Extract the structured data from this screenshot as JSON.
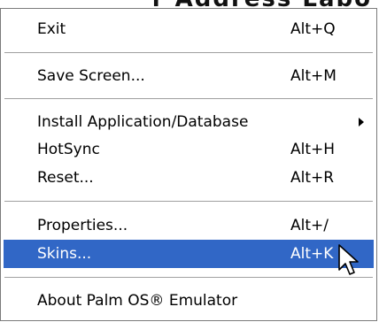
{
  "background": {
    "partial_text": "r  Address   Labo"
  },
  "menu": {
    "items": [
      {
        "label": "Exit",
        "accel": "Alt+Q"
      },
      {
        "label": "Save Screen...",
        "accel": "Alt+M"
      },
      {
        "label": "Install Application/Database",
        "has_submenu": true
      },
      {
        "label": "HotSync",
        "accel": "Alt+H"
      },
      {
        "label": "Reset...",
        "accel": "Alt+R"
      },
      {
        "label": "Properties...",
        "accel": "Alt+/"
      },
      {
        "label": "Skins...",
        "accel": "Alt+K",
        "highlighted": true
      },
      {
        "label": "About Palm OS® Emulator"
      }
    ],
    "highlight_color": "#3167c6"
  },
  "cursor": {
    "icon": "arrow-pointer-icon"
  }
}
